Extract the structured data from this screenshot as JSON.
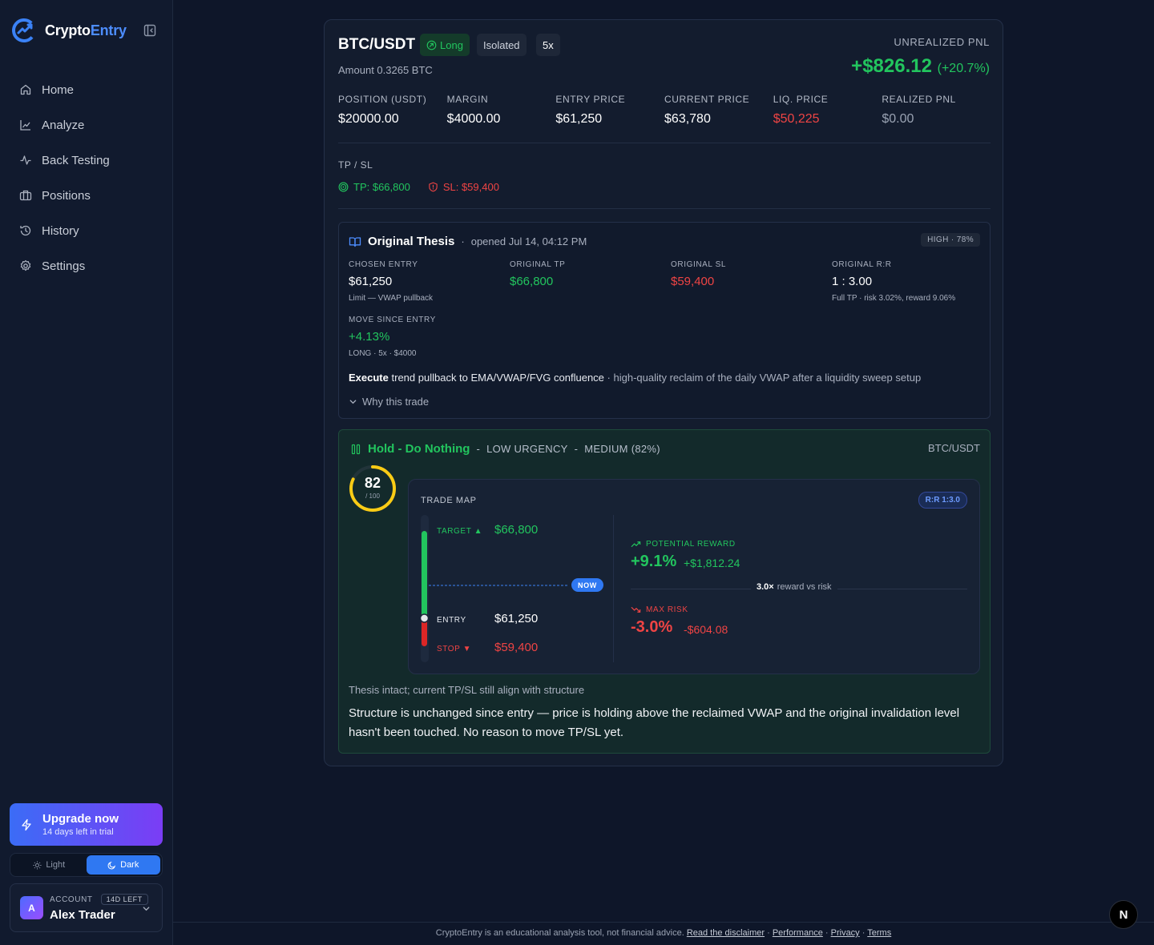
{
  "app": {
    "brand_prefix": "Crypto",
    "brand_suffix": "Entry",
    "accent": "#4d8dff"
  },
  "sidebar": {
    "items": [
      {
        "label": "Home",
        "icon": "home-icon"
      },
      {
        "label": "Analyze",
        "icon": "chart-line-icon"
      },
      {
        "label": "Back Testing",
        "icon": "activity-icon"
      },
      {
        "label": "Positions",
        "icon": "briefcase-icon"
      },
      {
        "label": "History",
        "icon": "history-icon"
      },
      {
        "label": "Settings",
        "icon": "gear-icon"
      }
    ],
    "upgrade": {
      "title": "Upgrade now",
      "subtitle": "14 days left in trial"
    },
    "theme": {
      "light": "Light",
      "dark": "Dark",
      "selected": "Dark"
    },
    "account": {
      "avatar": "A",
      "label": "ACCOUNT",
      "badge": "14D LEFT",
      "name": "Alex Trader"
    }
  },
  "position": {
    "pair": "BTC/USDT",
    "side": "Long",
    "margin_mode": "Isolated",
    "leverage": "5x",
    "amount": "Amount 0.3265 BTC",
    "unrealized_label": "UNREALIZED PNL",
    "unrealized_value": "+$826.12",
    "unrealized_pct": "(+20.7%)",
    "stats": [
      {
        "label": "POSITION (USDT)",
        "value": "$20000.00"
      },
      {
        "label": "MARGIN",
        "value": "$4000.00"
      },
      {
        "label": "ENTRY PRICE",
        "value": "$61,250"
      },
      {
        "label": "CURRENT PRICE",
        "value": "$63,780"
      },
      {
        "label": "LIQ. PRICE",
        "value": "$50,225"
      },
      {
        "label": "REALIZED PNL",
        "value": "$0.00"
      }
    ],
    "tpsl_label": "TP / SL",
    "tp": "TP: $66,800",
    "sl": "SL: $59,400"
  },
  "thesis": {
    "title": "Original Thesis",
    "opened": "opened Jul 14, 04:12 PM",
    "confidence": "HIGH · 78%",
    "cells": [
      {
        "label": "CHOSEN ENTRY",
        "value": "$61,250",
        "sub": "Limit — VWAP pullback"
      },
      {
        "label": "ORIGINAL TP",
        "value": "$66,800",
        "sub": ""
      },
      {
        "label": "ORIGINAL SL",
        "value": "$59,400",
        "sub": ""
      },
      {
        "label": "ORIGINAL R:R",
        "value": "1 : 3.00",
        "sub": "Full TP · risk 3.02%, reward 9.06%"
      },
      {
        "label": "MOVE SINCE ENTRY",
        "value": "+4.13%",
        "sub": "LONG · 5x · $4000"
      }
    ],
    "summary_action": "Execute",
    "summary_plan": "trend pullback to EMA/VWAP/FVG confluence",
    "summary_rest": "· high-quality reclaim of the daily VWAP after a liquidity sweep setup",
    "why": "Why this trade"
  },
  "advice": {
    "title": "Hold - Do Nothing",
    "urgency": "LOW URGENCY",
    "confidence": "MEDIUM (82%)",
    "pair": "BTC/USDT",
    "score": "82",
    "score_value": 82,
    "score_max_label": "/ 100",
    "status": "Thesis intact; current TP/SL still align with structure",
    "body": "Structure is unchanged since entry — price is holding above the reclaimed VWAP and the original invalidation level hasn't been touched. No reason to move TP/SL yet."
  },
  "trade_map": {
    "title": "TRADE MAP",
    "rr_badge": "R:R 1:3.0",
    "target_label": "TARGET ▲",
    "target_price": "$66,800",
    "entry_label": "ENTRY",
    "entry_price": "$61,250",
    "stop_label": "STOP ▼",
    "stop_price": "$59,400",
    "now_label": "NOW",
    "reward_label": "POTENTIAL REWARD",
    "reward_pct": "+9.1%",
    "reward_usd": "+$1,812.24",
    "ratio": "3.0×",
    "ratio_text": "reward vs risk",
    "risk_label": "MAX RISK",
    "risk_pct": "-3.0%",
    "risk_usd": "-$604.08"
  },
  "footer": {
    "text": "CryptoEntry is an educational analysis tool, not financial advice.",
    "links": [
      "Read the disclaimer",
      "Performance",
      "Privacy",
      "Terms"
    ],
    "sep": "·"
  },
  "colors": {
    "green": "#22c55e",
    "red": "#ef4444",
    "blue": "#2f78f2",
    "gauge": "#facc15"
  }
}
